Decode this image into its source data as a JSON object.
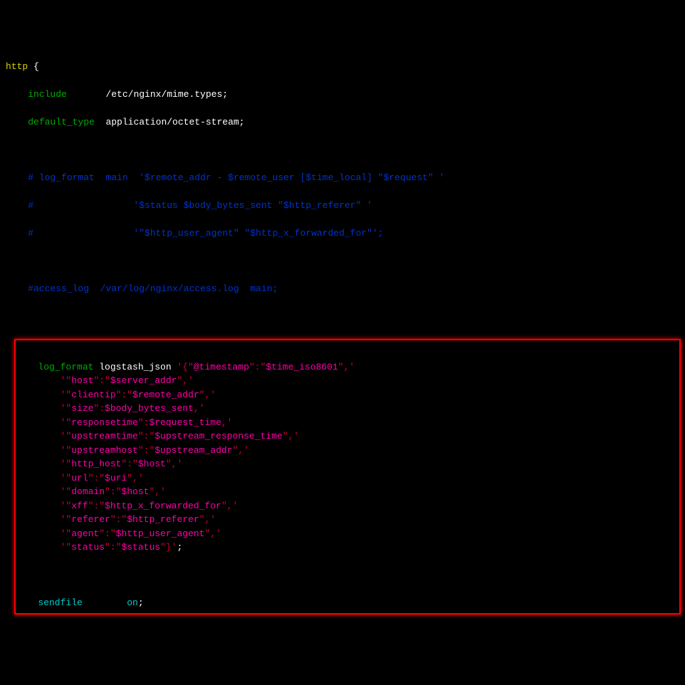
{
  "l1": {
    "a": "http",
    "b": " {"
  },
  "l2": {
    "pad": "    ",
    "a": "include",
    "b": "       /etc/nginx/mime.types;"
  },
  "l3": {
    "pad": "    ",
    "a": "default_type",
    "b": "  application/octet-stream;"
  },
  "c1": "    # log_format  main  '$remote_addr - $remote_user [$time_local] \"$request\" '",
  "c2": "    #                  '$status $body_bytes_sent \"$http_referer\" '",
  "c3": "    #                  '\"$http_user_agent\" \"$http_x_forwarded_for\"';",
  "c4": "    #access_log  /var/log/nginx/access.log  main;",
  "lf": {
    "pad": "   ",
    "a": "log_format",
    "b": " logstash_json ",
    "s1": "'{\"",
    "t1": "@timestamp",
    "s2": "\":\"",
    "v1": "$time_iso8601",
    "s3": "\",'"
  },
  "rows": [
    {
      "k": "host",
      "v": "$server_addr",
      "qv": true
    },
    {
      "k": "clientip",
      "v": "$remote_addr",
      "qv": true
    },
    {
      "k": "size",
      "v": "$body_bytes_sent",
      "qv": false
    },
    {
      "k": "responsetime",
      "v": "$request_time",
      "qv": false
    },
    {
      "k": "upstreamtime",
      "v": "$upstream_response_time",
      "qv": true
    },
    {
      "k": "upstreamhost",
      "v": "$upstream_addr",
      "qv": true
    },
    {
      "k": "http_host",
      "v": "$host",
      "qv": true
    },
    {
      "k": "url",
      "v": "$uri",
      "qv": true
    },
    {
      "k": "domain",
      "v": "$host",
      "qv": true
    },
    {
      "k": "xff",
      "v": "$http_x_forwarded_for",
      "qv": true
    },
    {
      "k": "referer",
      "v": "$http_referer",
      "qv": true
    },
    {
      "k": "agent",
      "v": "$http_user_agent",
      "qv": true
    }
  ],
  "last": {
    "k": "status",
    "v": "$status"
  },
  "row_indent": "       ",
  "sf": {
    "pad": "   ",
    "a": "sendfile",
    "b": "        ",
    "c": "on",
    "d": ";"
  }
}
